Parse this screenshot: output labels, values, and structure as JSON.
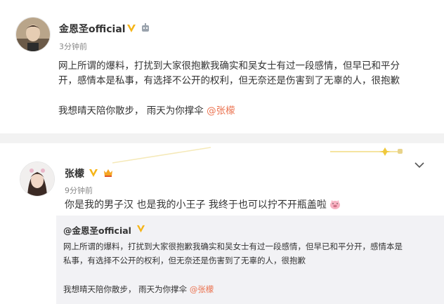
{
  "post1": {
    "author": "金恩圣official",
    "time": "3分钟前",
    "lines": [
      "网上所谓的爆料，打扰到大家很抱歉我确实和吴女士有过一段感情，但早已和平分",
      "开，感情本是私事，有选择不公开的权利，但无奈还是伤害到了无辜的人，很抱歉"
    ],
    "line3_text": "我想晴天陪你散步，  雨天为你撑伞  ",
    "mention": "@张檬"
  },
  "post2": {
    "author": "张檬",
    "time": "9分钟前",
    "text": "你是我的男子汉  也是我的小王子  我终于也可以拧不开瓶盖啦",
    "quote": {
      "author": "@金恩圣official",
      "lines": [
        "网上所谓的爆料，打扰到大家很抱歉我确实和吴女士有过一段感情，但早已和平分开，感情本是",
        "私事，有选择不公开的权利，但无奈还是伤害到了无辜的人，很抱歉"
      ],
      "line3_text": "我想晴天陪你散步，  雨天为你撑伞  ",
      "mention": "@张檬"
    }
  },
  "colors": {
    "mention": "#eb7350",
    "verified": "#f5b417",
    "quote_bg": "#f2f2f5"
  },
  "icons": [
    "verified-badge-icon",
    "crown-badge-icon",
    "chevron-down-icon",
    "pig-emoji-icon"
  ]
}
